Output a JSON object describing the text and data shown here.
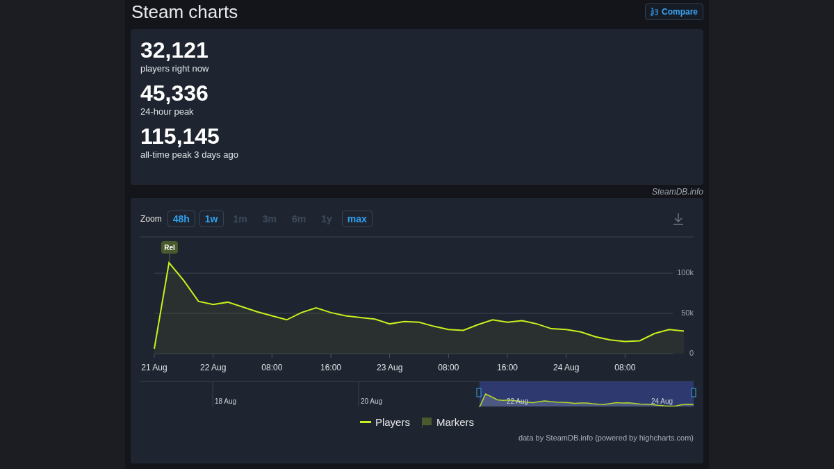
{
  "header": {
    "title": "Steam charts",
    "compare_button": "Compare"
  },
  "stats": [
    {
      "value": "32,121",
      "label": "players right now"
    },
    {
      "value": "45,336",
      "label": "24-hour peak"
    },
    {
      "value": "115,145",
      "label": "all-time peak 3 days ago"
    }
  ],
  "source_note": "SteamDB.info",
  "zoom": {
    "label": "Zoom",
    "buttons": [
      {
        "label": "48h",
        "disabled": false
      },
      {
        "label": "1w",
        "disabled": false
      },
      {
        "label": "1m",
        "disabled": true
      },
      {
        "label": "3m",
        "disabled": true
      },
      {
        "label": "6m",
        "disabled": true
      },
      {
        "label": "1y",
        "disabled": true
      },
      {
        "label": "max",
        "disabled": false
      }
    ]
  },
  "marker": {
    "label": "Rel"
  },
  "chart_data": {
    "type": "area",
    "categories": [
      "21 Aug",
      null,
      null,
      null,
      "22 Aug",
      null,
      null,
      null,
      "08:00",
      null,
      null,
      null,
      "16:00",
      null,
      null,
      null,
      "23 Aug",
      null,
      null,
      null,
      "08:00",
      null,
      null,
      null,
      "16:00",
      null,
      null,
      null,
      "24 Aug",
      null,
      null,
      null,
      "08:00",
      null,
      null,
      null,
      null
    ],
    "series": [
      {
        "name": "Players",
        "color": "#c8f01e",
        "values": [
          6000,
          113000,
          91000,
          65000,
          61000,
          64000,
          58000,
          52000,
          47000,
          42000,
          51000,
          57000,
          51000,
          47000,
          45000,
          43000,
          37000,
          40000,
          39000,
          34000,
          30000,
          29000,
          36000,
          42000,
          39000,
          41000,
          37000,
          31000,
          30000,
          27000,
          21000,
          17000,
          15000,
          16000,
          25000,
          30000,
          28000
        ]
      }
    ],
    "ylim": [
      0,
      193000
    ],
    "yticks": [
      {
        "value": 0,
        "label": "0"
      },
      {
        "value": 50000,
        "label": "50k"
      },
      {
        "value": 100000,
        "label": "100k"
      }
    ]
  },
  "navigator": {
    "labels": [
      "18 Aug",
      "20 Aug",
      "22 Aug",
      "24 Aug"
    ]
  },
  "legend": [
    {
      "kind": "line"
    },
    {
      "label": "Markers",
      "kind": "flag"
    }
  ],
  "credits": "data by SteamDB.info (powered by highcharts.com)"
}
